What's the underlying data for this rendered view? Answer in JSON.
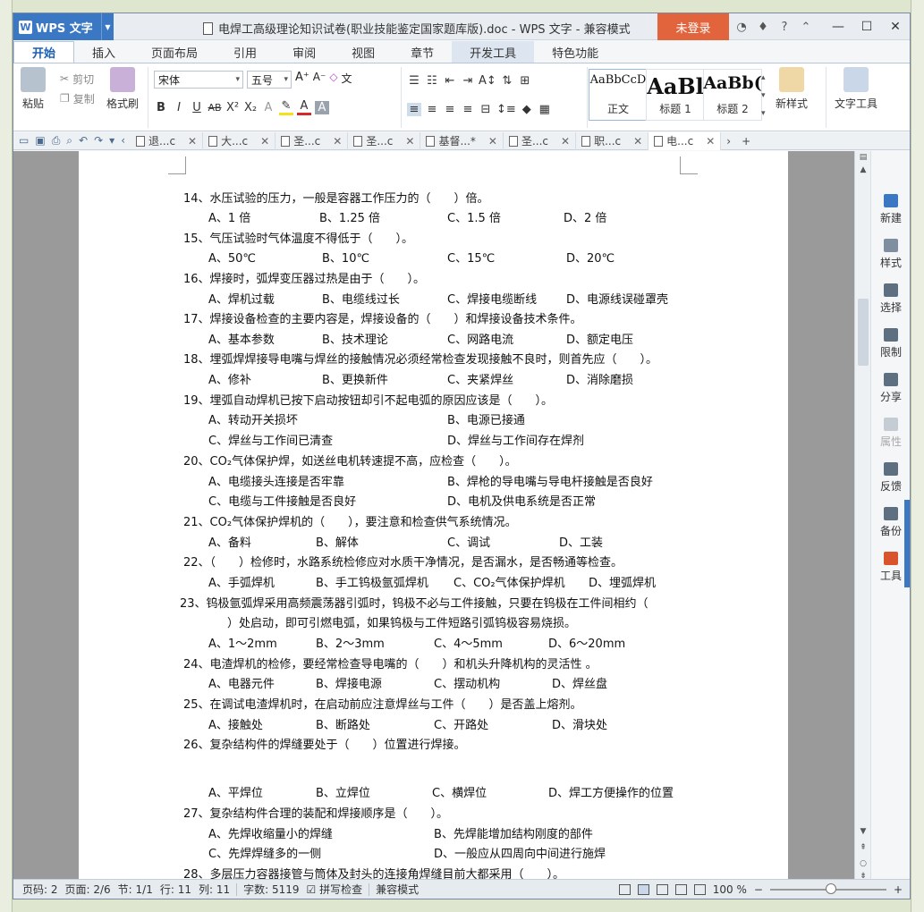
{
  "titlebar": {
    "app_name": "WPS 文字",
    "doc_title": "电焊工高级理论知识试卷(职业技能鉴定国家题库版).doc - WPS 文字 - 兼容模式",
    "login_label": "未登录"
  },
  "ribbon_tabs": [
    "开始",
    "插入",
    "页面布局",
    "引用",
    "审阅",
    "视图",
    "章节",
    "开发工具",
    "特色功能"
  ],
  "ribbon": {
    "paste": "粘贴",
    "cut": "剪切",
    "copy": "复制",
    "format_painter": "格式刷",
    "font_name": "宋体",
    "font_size": "五号",
    "styles": [
      {
        "sample": "AaBbCcD",
        "label": "正文"
      },
      {
        "sample": "AaBl",
        "label": "标题 1"
      },
      {
        "sample": "AaBb(",
        "label": "标题 2"
      }
    ],
    "new_style": "新样式",
    "text_tools": "文字工具"
  },
  "doc_tabs": [
    "退...c",
    "大...c",
    "圣...c",
    "圣...c",
    "基督...*",
    "圣...c",
    "职...c",
    "电...c"
  ],
  "document": {
    "lines": [
      "14、水压试验的压力，一般是容器工作压力的（　　）倍。",
      "15、气压试验时气体温度不得低于（　　）。",
      "16、焊接时，弧焊变压器过热是由于（　　）。",
      "17、焊接设备检查的主要内容是，焊接设备的（　　）和焊接设备技术条件。",
      "18、埋弧焊焊接导电嘴与焊丝的接触情况必须经常检查发现接触不良时，则首先应（　　）。",
      "19、埋弧自动焊机已按下启动按钮却引不起电弧的原因应该是（　　）。",
      "20、CO₂气体保护焊，如送丝电机转速提不高，应检查（　　）。",
      "21、CO₂气体保护焊机的（　　），要注意和检查供气系统情况。",
      "22、（　　）检修时，水路系统检修应对水质干净情况，是否漏水，是否畅通等检查。",
      "23、钨极氩弧焊采用高频震荡器引弧时，钨极不必与工件接触，只要在钨极在工件间相约（",
      "　）处启动，即可引燃电弧，如果钨极与工件短路引弧钨极容易烧损。",
      "24、电渣焊机的检修，要经常检查导电嘴的（　　）和机头升降机构的灵活性 。",
      "25、在调试电渣焊机时，在启动前应注意焊丝与工件（　　）是否盖上熔剂。",
      "26、复杂结构件的焊缝要处于（　　）位置进行焊接。",
      "27、复杂结构件合理的装配和焊接顺序是（　　）。",
      "28、多层压力容器接管与筒体及封头的连接角焊缝目前大都采用（　　）。"
    ],
    "options": {
      "q14": [
        "A、1 倍",
        "B、1.25 倍",
        "C、1.5 倍",
        "D、2 倍"
      ],
      "q15": [
        "A、50℃",
        "B、10℃",
        "C、15℃",
        "D、20℃"
      ],
      "q16": [
        "A、焊机过载",
        "B、电缆线过长",
        "C、焊接电缆断线",
        "D、电源线误碰罩壳"
      ],
      "q17": [
        "A、基本参数",
        "B、技术理论",
        "C、网路电流",
        "D、额定电压"
      ],
      "q18": [
        "A、修补",
        "B、更换新件",
        "C、夹紧焊丝",
        "D、消除磨损"
      ],
      "q19": [
        "A、转动开关损坏",
        "B、电源已接通",
        "C、焊丝与工作间已清查",
        "D、焊丝与工作间存在焊剂"
      ],
      "q20": [
        "A、电缆接头连接是否牢靠",
        "B、焊枪的导电嘴与导电杆接触是否良好",
        "C、电缆与工件接触是否良好",
        "D、电机及供电系统是否正常"
      ],
      "q21": [
        "A、备料",
        "B、解体",
        "C、调试",
        "D、工装"
      ],
      "q22": [
        "A、手弧焊机",
        "B、手工钨极氩弧焊机",
        "C、CO₂气体保护焊机",
        "D、埋弧焊机"
      ],
      "q23": [
        "A、1～2mm",
        "B、2～3mm",
        "C、4～5mm",
        "D、6～20mm"
      ],
      "q24": [
        "A、电器元件",
        "B、焊接电源",
        "C、摆动机构",
        "D、焊丝盘"
      ],
      "q25": [
        "A、接触处",
        "B、断路处",
        "C、开路处",
        "D、滑块处"
      ],
      "q26": [
        "A、平焊位",
        "B、立焊位",
        "C、横焊位",
        "D、焊工方便操作的位置"
      ],
      "q27": [
        "A、先焊收缩量小的焊缝",
        "B、先焊能增加结构刚度的部件",
        "C、先焊焊缝多的一侧",
        "D、一般应从四周向中间进行施焊"
      ]
    }
  },
  "sidepanel": [
    "新建",
    "样式",
    "选择",
    "限制",
    "分享",
    "属性",
    "反馈",
    "备份",
    "工具"
  ],
  "statusbar": {
    "page_code": "页码: 2",
    "pages": "页面: 2/6",
    "section": "节: 1/1",
    "row": "行: 11",
    "col": "列: 11",
    "word_count": "字数: 5119",
    "spellcheck": "拼写检查",
    "compat": "兼容模式",
    "zoom": "100 %"
  },
  "colors": {
    "accent": "#3b78c4",
    "login": "#e2643c"
  }
}
